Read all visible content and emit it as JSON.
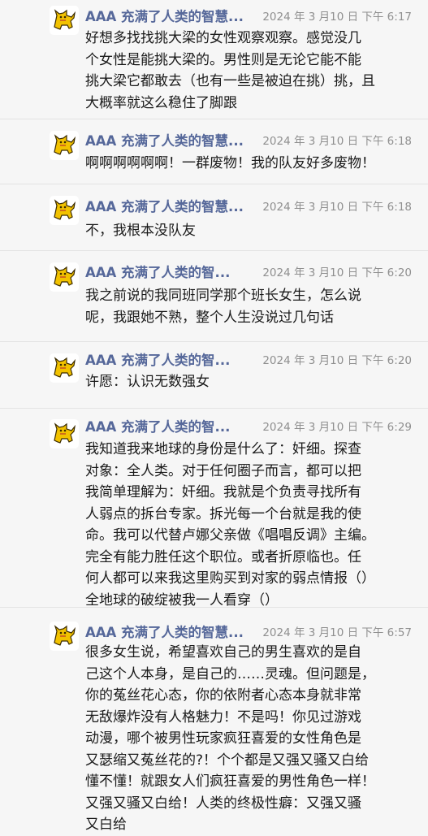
{
  "messages": [
    {
      "sender": "AAA 充满了人类的智慧...",
      "time": "2024 年 3 月10 日  下午 6:17",
      "text": "好想多找找挑大梁的女性观察观察。感觉没几\n个女性是能挑大梁的。男性则是无论它能不能\n挑大梁它都敢去（也有一些是被迫在挑）挑，且\n大概率就这么稳住了脚跟"
    },
    {
      "sender": "AAA 充满了人类的智慧...",
      "time": "2024 年 3 月10 日  下午 6:18",
      "text": "啊啊啊啊啊啊！一群废物！我的队友好多废物！"
    },
    {
      "sender": "AAA 充满了人类的智慧...",
      "time": "2024 年 3 月10 日  下午 6:18",
      "text": "不，我根本没队友"
    },
    {
      "sender": "AAA 充满了人类的智...",
      "time": "2024 年 3 月10 日  下午 6:20",
      "text": "我之前说的我同班同学那个班长女生，怎么说\n呢，我跟她不熟，整个人生没说过几句话"
    },
    {
      "sender": "AAA 充满了人类的智...",
      "time": "2024 年 3 月10 日  下午 6:20",
      "text": "许愿：认识无数强女"
    },
    {
      "sender": "AAA 充满了人类的智...",
      "time": "2024 年 3 月10 日  下午 6:29",
      "text": "我知道我来地球的身份是什么了：奸细。探查\n对象：全人类。对于任何圈子而言，都可以把\n我简单理解为：奸细。我就是个负责寻找所有\n人弱点的拆台专家。拆光每一个台就是我的使\n命。我可以代替卢娜父亲做《唱唱反调》主编。\n完全有能力胜任这个职位。或者折原临也。任\n何人都可以来我这里购买到对家的弱点情报（）\n全地球的破绽被我一人看穿（）"
    },
    {
      "sender": "AAA 充满了人类的智慧...",
      "time": "2024 年 3 月10 日  下午 6:57",
      "text": "很多女生说，希望喜欢自己的男生喜欢的是自\n己这个人本身，是自己的……灵魂。但问题是，\n你的菟丝花心态，你的依附者心态本身就非常\n无敌爆炸没有人格魅力！不是吗！你见过游戏\n动漫，哪个被男性玩家疯狂喜爱的女性角色是\n又瑟缩又菟丝花的?！个个都是又强又骚又白给\n懂不懂！就跟女人们疯狂喜爱的男性角色一样！\n又强又骚又白给！人类的终极性癖：又强又骚\n又白给"
    }
  ],
  "colors": {
    "background": "#f6f6f6",
    "sender": "#56689a",
    "timestamp": "#8f8f8f",
    "text": "#1a1a1a",
    "divider": "#e3e3e3"
  },
  "icons": {
    "avatar": "yellow-cat-icon"
  }
}
